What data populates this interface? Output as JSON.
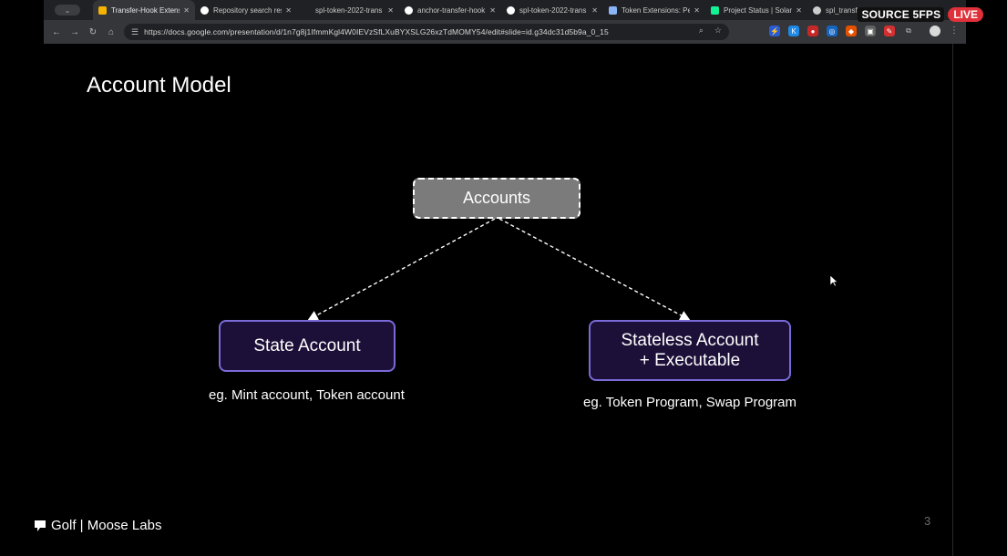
{
  "browser": {
    "tabs": [
      {
        "label": "Transfer-Hook Extens",
        "active": true,
        "favicon": "slides-icon",
        "color": "#f4b400"
      },
      {
        "label": "Repository search res",
        "active": false,
        "favicon": "github-icon",
        "color": "#ffffff"
      },
      {
        "label": "spl-token-2022-trans",
        "active": false,
        "favicon": "",
        "color": "#202124"
      },
      {
        "label": "anchor-transfer-hook",
        "active": false,
        "favicon": "github-icon",
        "color": "#ffffff"
      },
      {
        "label": "spl-token-2022-trans",
        "active": false,
        "favicon": "github-icon",
        "color": "#ffffff"
      },
      {
        "label": "Token Extensions: Per",
        "active": false,
        "favicon": "list-icon",
        "color": "#8ab4f8"
      },
      {
        "label": "Project Status | Solan",
        "active": false,
        "favicon": "status-icon",
        "color": "#14f195"
      },
      {
        "label": "spl_transfer_ho",
        "active": false,
        "favicon": "globe-icon",
        "color": "#cccccc"
      }
    ],
    "close_glyph": "✕",
    "url": "https://docs.google.com/presentation/d/1n7g8j1IfmmKgl4W0IEVzSfLXuBYXSLG26xzTdMOMY54/edit#slide=id.g34dc31d5b9a_0_15"
  },
  "overlay": {
    "source_label": "SOURCE 5FPS",
    "live_label": "LIVE"
  },
  "slide": {
    "title": "Account Model",
    "diagram": {
      "root": {
        "label": "Accounts"
      },
      "left": {
        "label": "State Account",
        "caption": "eg. Mint account, Token account"
      },
      "right": {
        "label_line1": "Stateless Account",
        "label_line2": "+ Executable",
        "caption": "eg. Token Program, Swap Program"
      }
    },
    "footer": "Golf | Moose Labs",
    "page_number": "3"
  },
  "colors": {
    "accent_border": "#7a6ad8",
    "node_fill": "#1c1038",
    "root_fill": "#7b7b7b",
    "live": "#e0303a"
  }
}
